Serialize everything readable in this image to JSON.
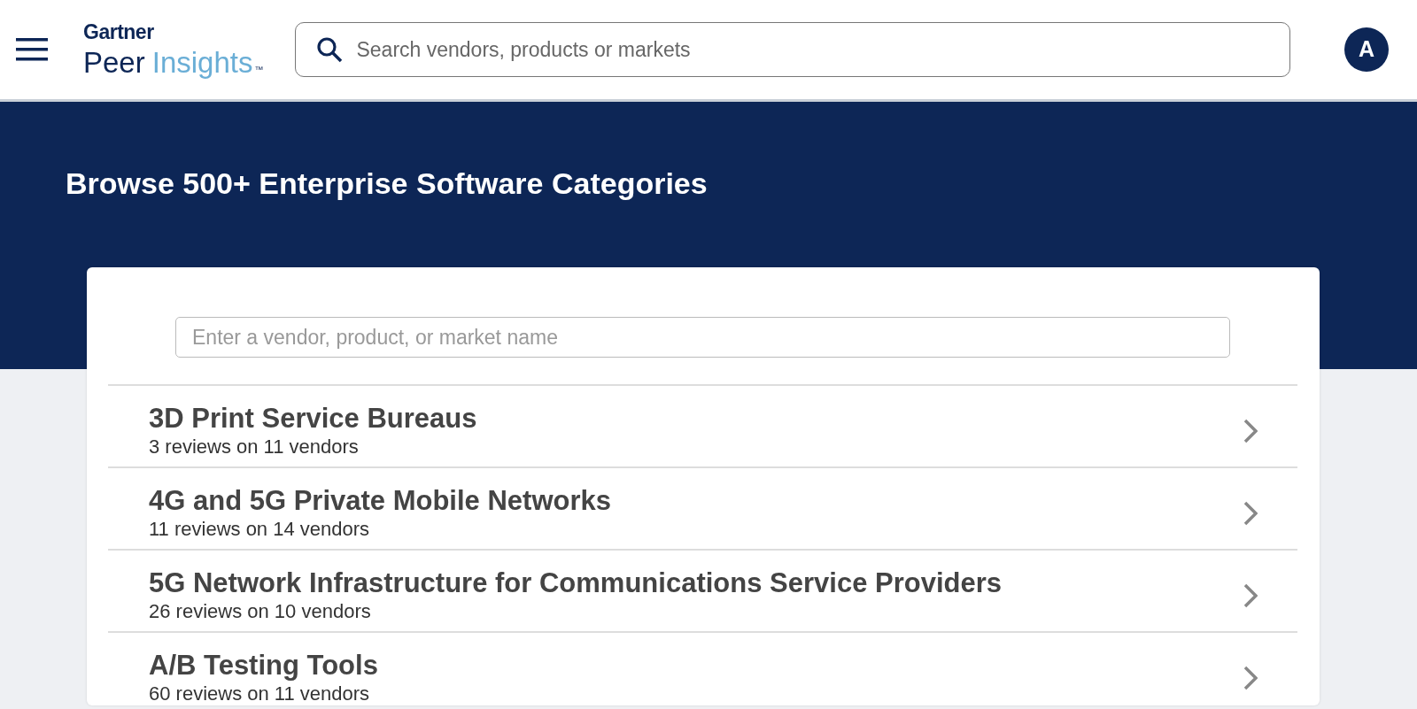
{
  "header": {
    "logo": {
      "brand": "Gartner",
      "product_first": "Peer",
      "product_second": "Insights",
      "trademark": "™"
    },
    "search": {
      "placeholder": "Search vendors, products or markets"
    },
    "avatar": "A"
  },
  "banner": {
    "title": "Browse 500+ Enterprise Software Categories"
  },
  "filter": {
    "placeholder": "Enter a vendor, product, or market name"
  },
  "categories": [
    {
      "name": "3D Print Service Bureaus",
      "stats": "3 reviews on 11 vendors"
    },
    {
      "name": "4G and 5G Private Mobile Networks",
      "stats": "11 reviews on 14 vendors"
    },
    {
      "name": "5G Network Infrastructure for Communications Service Providers",
      "stats": "26 reviews on 10 vendors"
    },
    {
      "name": "A/B Testing Tools",
      "stats": "60 reviews on 11 vendors"
    }
  ]
}
